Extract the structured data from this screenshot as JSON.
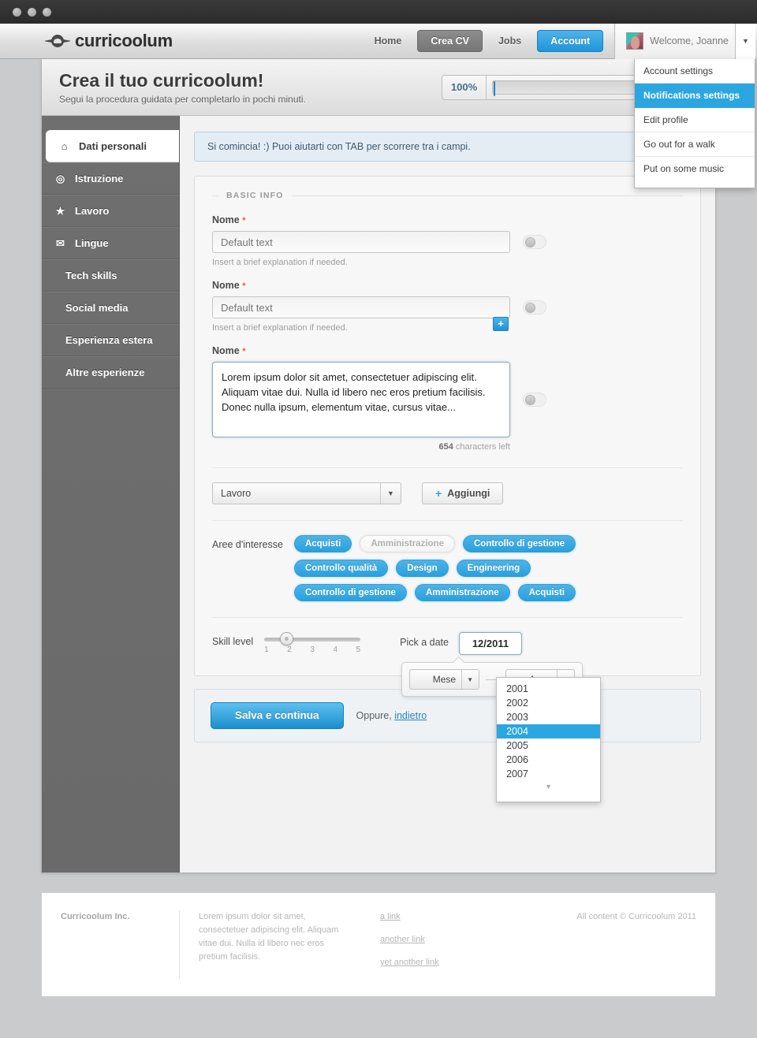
{
  "topbar": {
    "brand": "curricoolum",
    "nav": [
      {
        "label": "Home",
        "style": "plain"
      },
      {
        "label": "Crea CV",
        "style": "dark"
      },
      {
        "label": "Jobs",
        "style": "plain"
      },
      {
        "label": "Account",
        "style": "blue"
      }
    ],
    "welcome": "Welcome, Joanne",
    "caret": "▼",
    "dropdown": [
      {
        "label": "Account settings",
        "selected": false
      },
      {
        "label": "Notifications settings",
        "selected": true
      },
      {
        "label": "Edit profile",
        "selected": false
      },
      {
        "label": "Go out for a walk",
        "selected": false
      },
      {
        "label": "Put on some music",
        "selected": false
      }
    ]
  },
  "header": {
    "title": "Crea il tuo curricoolum!",
    "subtitle": "Segui la procedura guidata per completarlo in pochi minuti.",
    "progress_label": "100%",
    "progress_value": 100
  },
  "sidebar": {
    "items": [
      {
        "label": "Dati personali",
        "icon": "⌂",
        "icon_name": "home-icon",
        "active": true,
        "indent": false
      },
      {
        "label": "Istruzione",
        "icon": "◎",
        "icon_name": "target-icon",
        "active": false,
        "indent": false
      },
      {
        "label": "Lavoro",
        "icon": "★",
        "icon_name": "star-icon",
        "active": false,
        "indent": false
      },
      {
        "label": "Lingue",
        "icon": "✉",
        "icon_name": "envelope-icon",
        "active": false,
        "indent": false
      },
      {
        "label": "Tech skills",
        "icon": "",
        "icon_name": "",
        "active": false,
        "indent": true
      },
      {
        "label": "Social media",
        "icon": "",
        "icon_name": "",
        "active": false,
        "indent": true
      },
      {
        "label": "Esperienza estera",
        "icon": "",
        "icon_name": "",
        "active": false,
        "indent": true
      },
      {
        "label": "Altre esperienze",
        "icon": "",
        "icon_name": "",
        "active": false,
        "indent": true
      }
    ]
  },
  "content": {
    "notice": "Si comincia! :) Puoi aiutarti con TAB per scorrere tra i campi.",
    "legend": "BASIC INFO",
    "field1": {
      "label": "Nome",
      "required": "*",
      "placeholder": "Default text",
      "value": "",
      "hint": "Insert a brief explanation if needed."
    },
    "field2": {
      "label": "Nome",
      "required": "*",
      "placeholder": "Default text",
      "value": "",
      "hint": "Insert a brief explanation if needed.",
      "plus_label": "+"
    },
    "field3": {
      "label": "Nome",
      "required": "*",
      "value": "Lorem ipsum dolor sit amet, consectetuer adipiscing elit. Aliquam vitae dui. Nulla id libero nec eros pretium facilisis. Donec nulla ipsum, elementum vitae, cursus vitae...",
      "counter_number": "654",
      "counter_text": "characters left"
    },
    "select_value": "Lavoro",
    "add_button": "Aggiungi",
    "add_icon": "+",
    "tags_label": "Aree d'interesse",
    "tags": [
      {
        "label": "Acquisti",
        "on": true
      },
      {
        "label": "Amministrazione",
        "on": false
      },
      {
        "label": "Controllo di gestione",
        "on": true
      },
      {
        "label": "Controllo qualità",
        "on": true
      },
      {
        "label": "Design",
        "on": true
      },
      {
        "label": "Engineering",
        "on": true
      },
      {
        "label": "Controllo di gestione",
        "on": true
      },
      {
        "label": "Amministrazione",
        "on": true
      },
      {
        "label": "Acquisti",
        "on": true
      }
    ],
    "slider": {
      "label": "Skill level",
      "value": 2,
      "ticks": [
        "1",
        "2",
        "3",
        "4",
        "5"
      ]
    },
    "date": {
      "label": "Pick a date",
      "value": "12/2011",
      "month_placeholder": "Mese",
      "year_placeholder": "Anno",
      "years": [
        "2001",
        "2002",
        "2003",
        "2004",
        "2005",
        "2006",
        "2007"
      ],
      "selected_year": "2004",
      "more_arrow": "▼"
    },
    "save_button": "Salva e continua",
    "or_text": "Oppure,",
    "back_link": "indietro"
  },
  "footer": {
    "company": "Curricoolum Inc.",
    "blurb": "Lorem ipsum dolor sit amet, consectetuer adipiscing elit. Aliquam vitae dui. Nulla id libero nec eros pretium facilisis.",
    "links": [
      "a link",
      "another link",
      "yet another link"
    ],
    "copyright": "All content © Curricoolum 2011"
  },
  "colors": {
    "accent": "#2b9fdc",
    "required": "#e8564a",
    "sidebar": "#6f6f6f"
  }
}
